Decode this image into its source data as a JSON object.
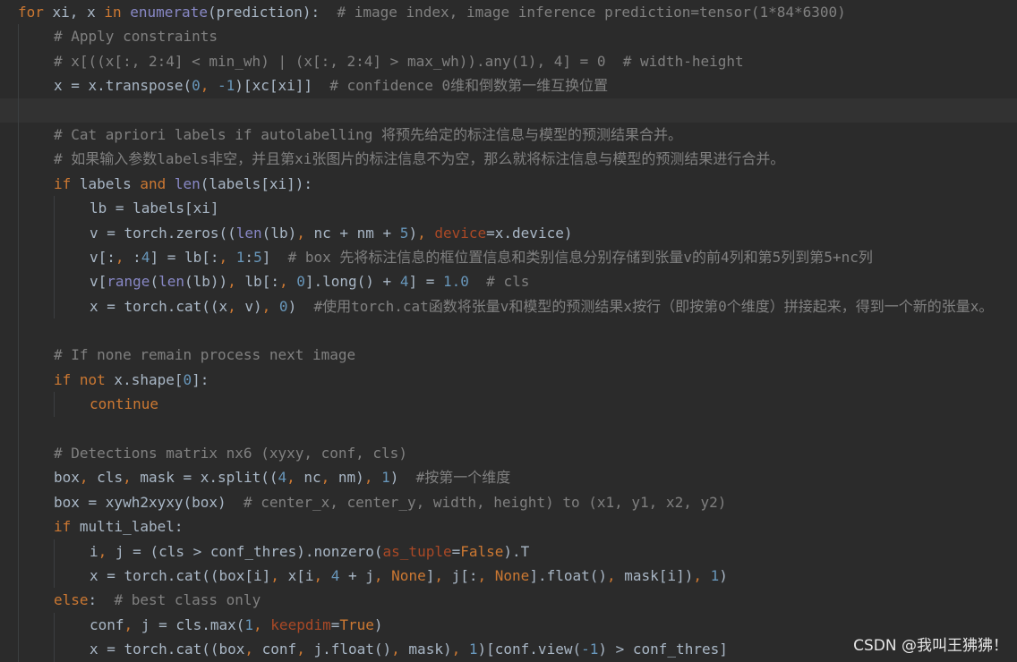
{
  "window": {
    "type": "code-editor",
    "theme": "Darcula",
    "colors": {
      "background": "#2b2b2b",
      "default_text": "#a9b7c6",
      "keyword": "#cc7832",
      "builtin": "#8888c6",
      "number": "#6897bb",
      "comment": "#808080",
      "keyword_argument": "#aa4926",
      "current_line": "#323232"
    }
  },
  "code_lines": [
    {
      "indent": 0,
      "tokens": [
        {
          "t": "for",
          "c": "kw"
        },
        {
          "t": " xi, x ",
          "c": "plain"
        },
        {
          "t": "in",
          "c": "kw"
        },
        {
          "t": " ",
          "c": "plain"
        },
        {
          "t": "enumerate",
          "c": "bi"
        },
        {
          "t": "(prediction):  ",
          "c": "plain"
        },
        {
          "t": "# image index, image inference prediction=tensor(1*84*6300)",
          "c": "cm"
        }
      ]
    },
    {
      "indent": 1,
      "tokens": [
        {
          "t": "# Apply constraints",
          "c": "cm"
        }
      ]
    },
    {
      "indent": 1,
      "tokens": [
        {
          "t": "# x[((x[:, 2:4] < min_wh) | (x[:, 2:4] > max_wh)).any(1), 4] = 0  # width-height",
          "c": "cm"
        }
      ]
    },
    {
      "indent": 1,
      "tokens": [
        {
          "t": "x = x.transpose(",
          "c": "plain"
        },
        {
          "t": "0",
          "c": "num"
        },
        {
          "t": ", ",
          "c": "kw"
        },
        {
          "t": "-1",
          "c": "num"
        },
        {
          "t": ")[xc[xi]]  ",
          "c": "plain"
        },
        {
          "t": "# confidence 0维和倒数第一维互换位置",
          "c": "cm"
        }
      ]
    },
    {
      "indent": 1,
      "highlight": true,
      "tokens": []
    },
    {
      "indent": 1,
      "tokens": [
        {
          "t": "# Cat apriori labels if autolabelling 将预先给定的标注信息与模型的预测结果合并。",
          "c": "cm"
        }
      ]
    },
    {
      "indent": 1,
      "tokens": [
        {
          "t": "# 如果输入参数labels非空，并且第xi张图片的标注信息不为空，那么就将标注信息与模型的预测结果进行合并。",
          "c": "cm"
        }
      ]
    },
    {
      "indent": 1,
      "tokens": [
        {
          "t": "if",
          "c": "kw"
        },
        {
          "t": " labels ",
          "c": "plain"
        },
        {
          "t": "and",
          "c": "kw"
        },
        {
          "t": " ",
          "c": "plain"
        },
        {
          "t": "len",
          "c": "bi"
        },
        {
          "t": "(labels[xi]):",
          "c": "plain"
        }
      ]
    },
    {
      "indent": 2,
      "tokens": [
        {
          "t": "lb = labels[xi]",
          "c": "plain"
        }
      ]
    },
    {
      "indent": 2,
      "tokens": [
        {
          "t": "v = torch.zeros((",
          "c": "plain"
        },
        {
          "t": "len",
          "c": "bi"
        },
        {
          "t": "(lb)",
          "c": "plain"
        },
        {
          "t": ", ",
          "c": "kw"
        },
        {
          "t": "nc + nm + ",
          "c": "plain"
        },
        {
          "t": "5",
          "c": "num"
        },
        {
          "t": ")",
          "c": "plain"
        },
        {
          "t": ", ",
          "c": "kw"
        },
        {
          "t": "device",
          "c": "kwarg"
        },
        {
          "t": "=x.device)",
          "c": "plain"
        }
      ]
    },
    {
      "indent": 2,
      "tokens": [
        {
          "t": "v[:",
          "c": "plain"
        },
        {
          "t": ", ",
          "c": "kw"
        },
        {
          "t": ":",
          "c": "plain"
        },
        {
          "t": "4",
          "c": "num"
        },
        {
          "t": "] = lb[:",
          "c": "plain"
        },
        {
          "t": ", ",
          "c": "kw"
        },
        {
          "t": "1",
          "c": "num"
        },
        {
          "t": ":",
          "c": "plain"
        },
        {
          "t": "5",
          "c": "num"
        },
        {
          "t": "]  ",
          "c": "plain"
        },
        {
          "t": "# box 先将标注信息的框位置信息和类别信息分别存储到张量v的前4列和第5列到第5+nc列",
          "c": "cm"
        }
      ]
    },
    {
      "indent": 2,
      "tokens": [
        {
          "t": "v[",
          "c": "plain"
        },
        {
          "t": "range",
          "c": "bi"
        },
        {
          "t": "(",
          "c": "plain"
        },
        {
          "t": "len",
          "c": "bi"
        },
        {
          "t": "(lb))",
          "c": "plain"
        },
        {
          "t": ", ",
          "c": "kw"
        },
        {
          "t": "lb[:",
          "c": "plain"
        },
        {
          "t": ", ",
          "c": "kw"
        },
        {
          "t": "0",
          "c": "num"
        },
        {
          "t": "].long() + ",
          "c": "plain"
        },
        {
          "t": "4",
          "c": "num"
        },
        {
          "t": "] = ",
          "c": "plain"
        },
        {
          "t": "1.0",
          "c": "num"
        },
        {
          "t": "  ",
          "c": "plain"
        },
        {
          "t": "# cls",
          "c": "cm"
        }
      ]
    },
    {
      "indent": 2,
      "tokens": [
        {
          "t": "x = torch.cat((x",
          "c": "plain"
        },
        {
          "t": ", ",
          "c": "kw"
        },
        {
          "t": "v)",
          "c": "plain"
        },
        {
          "t": ", ",
          "c": "kw"
        },
        {
          "t": "0",
          "c": "num"
        },
        {
          "t": ")  ",
          "c": "plain"
        },
        {
          "t": "#使用torch.cat函数将张量v和模型的预测结果x按行（即按第0个维度）拼接起来，得到一个新的张量x。",
          "c": "cm"
        }
      ]
    },
    {
      "indent": 1,
      "tokens": []
    },
    {
      "indent": 1,
      "tokens": [
        {
          "t": "# If none remain process next image",
          "c": "cm"
        }
      ]
    },
    {
      "indent": 1,
      "tokens": [
        {
          "t": "if not",
          "c": "kw"
        },
        {
          "t": " x.shape[",
          "c": "plain"
        },
        {
          "t": "0",
          "c": "num"
        },
        {
          "t": "]:",
          "c": "plain"
        }
      ]
    },
    {
      "indent": 2,
      "tokens": [
        {
          "t": "continue",
          "c": "kw"
        }
      ]
    },
    {
      "indent": 1,
      "tokens": []
    },
    {
      "indent": 1,
      "tokens": [
        {
          "t": "# Detections matrix nx6 (xyxy, conf, cls)",
          "c": "cm"
        }
      ]
    },
    {
      "indent": 1,
      "tokens": [
        {
          "t": "box",
          "c": "plain"
        },
        {
          "t": ", ",
          "c": "kw"
        },
        {
          "t": "cls",
          "c": "plain"
        },
        {
          "t": ", ",
          "c": "kw"
        },
        {
          "t": "mask = x.split((",
          "c": "plain"
        },
        {
          "t": "4",
          "c": "num"
        },
        {
          "t": ", ",
          "c": "kw"
        },
        {
          "t": "nc",
          "c": "plain"
        },
        {
          "t": ", ",
          "c": "kw"
        },
        {
          "t": "nm)",
          "c": "plain"
        },
        {
          "t": ", ",
          "c": "kw"
        },
        {
          "t": "1",
          "c": "num"
        },
        {
          "t": ")  ",
          "c": "plain"
        },
        {
          "t": "#按第一个维度",
          "c": "cm"
        }
      ]
    },
    {
      "indent": 1,
      "tokens": [
        {
          "t": "box = xywh2xyxy(box)  ",
          "c": "plain"
        },
        {
          "t": "# center_x, center_y, width, height) to (x1, y1, x2, y2)",
          "c": "cm"
        }
      ]
    },
    {
      "indent": 1,
      "tokens": [
        {
          "t": "if",
          "c": "kw"
        },
        {
          "t": " multi_label:",
          "c": "plain"
        }
      ]
    },
    {
      "indent": 2,
      "tokens": [
        {
          "t": "i",
          "c": "plain"
        },
        {
          "t": ", ",
          "c": "kw"
        },
        {
          "t": "j = (cls > conf_thres).nonzero(",
          "c": "plain"
        },
        {
          "t": "as_tuple",
          "c": "kwarg"
        },
        {
          "t": "=",
          "c": "plain"
        },
        {
          "t": "False",
          "c": "kw"
        },
        {
          "t": ").T",
          "c": "plain"
        }
      ]
    },
    {
      "indent": 2,
      "tokens": [
        {
          "t": "x = torch.cat((box[i]",
          "c": "plain"
        },
        {
          "t": ", ",
          "c": "kw"
        },
        {
          "t": "x[i",
          "c": "plain"
        },
        {
          "t": ", ",
          "c": "kw"
        },
        {
          "t": "4",
          "c": "num"
        },
        {
          "t": " + j",
          "c": "plain"
        },
        {
          "t": ", ",
          "c": "kw"
        },
        {
          "t": "None",
          "c": "kw"
        },
        {
          "t": "]",
          "c": "plain"
        },
        {
          "t": ", ",
          "c": "kw"
        },
        {
          "t": "j[:",
          "c": "plain"
        },
        {
          "t": ", ",
          "c": "kw"
        },
        {
          "t": "None",
          "c": "kw"
        },
        {
          "t": "].float()",
          "c": "plain"
        },
        {
          "t": ", ",
          "c": "kw"
        },
        {
          "t": "mask[i])",
          "c": "plain"
        },
        {
          "t": ", ",
          "c": "kw"
        },
        {
          "t": "1",
          "c": "num"
        },
        {
          "t": ")",
          "c": "plain"
        }
      ]
    },
    {
      "indent": 1,
      "tokens": [
        {
          "t": "else",
          "c": "kw"
        },
        {
          "t": ":  ",
          "c": "plain"
        },
        {
          "t": "# best class only",
          "c": "cm"
        }
      ]
    },
    {
      "indent": 2,
      "tokens": [
        {
          "t": "conf",
          "c": "plain"
        },
        {
          "t": ", ",
          "c": "kw"
        },
        {
          "t": "j = cls.max(",
          "c": "plain"
        },
        {
          "t": "1",
          "c": "num"
        },
        {
          "t": ", ",
          "c": "kw"
        },
        {
          "t": "keepdim",
          "c": "kwarg"
        },
        {
          "t": "=",
          "c": "plain"
        },
        {
          "t": "True",
          "c": "kw"
        },
        {
          "t": ")",
          "c": "plain"
        }
      ]
    },
    {
      "indent": 2,
      "tokens": [
        {
          "t": "x = torch.cat((box",
          "c": "plain"
        },
        {
          "t": ", ",
          "c": "kw"
        },
        {
          "t": "conf",
          "c": "plain"
        },
        {
          "t": ", ",
          "c": "kw"
        },
        {
          "t": "j.float()",
          "c": "plain"
        },
        {
          "t": ", ",
          "c": "kw"
        },
        {
          "t": "mask)",
          "c": "plain"
        },
        {
          "t": ", ",
          "c": "kw"
        },
        {
          "t": "1",
          "c": "num"
        },
        {
          "t": ")[conf.view(",
          "c": "plain"
        },
        {
          "t": "-1",
          "c": "num"
        },
        {
          "t": ") > conf_thres]",
          "c": "plain"
        }
      ]
    }
  ],
  "watermark": {
    "text": "CSDN @我叫王狒狒！"
  }
}
